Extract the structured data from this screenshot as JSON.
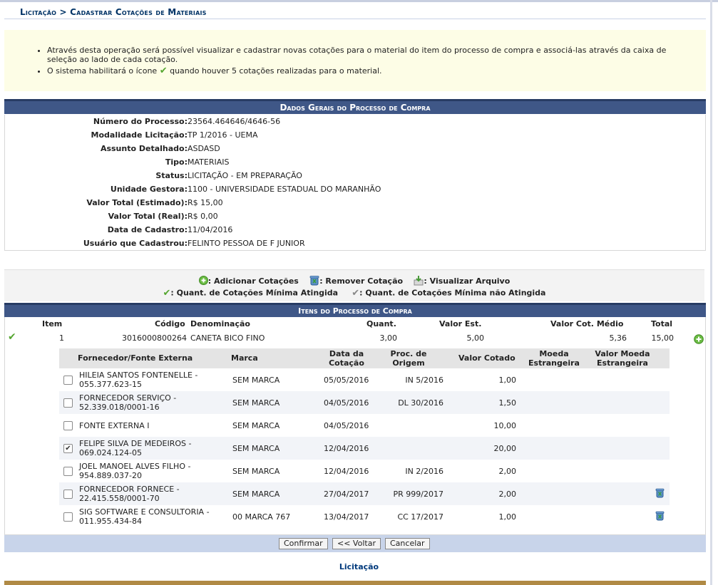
{
  "breadcrumb": "Licitação > Cadastrar Cotações de Materiais",
  "info": {
    "line1": "Através desta operação será possível visualizar e cadastrar novas cotações para o material do item do processo de compra e associá-las através da caixa de seleção ao lado de cada cotação.",
    "line2_a": "O sistema habilitará o ícone",
    "line2_b": "quando houver 5 cotações realizadas para o material."
  },
  "general": {
    "title": "Dados Gerais do Processo de Compra",
    "fields": [
      {
        "label": "Número do Processo:",
        "value": "23564.464646/4646-56"
      },
      {
        "label": "Modalidade Licitação:",
        "value": "TP 1/2016 - UEMA"
      },
      {
        "label": "Assunto Detalhado:",
        "value": "ASDASD"
      },
      {
        "label": "Tipo:",
        "value": "MATERIAIS"
      },
      {
        "label": "Status:",
        "value": "LICITAÇÃO - EM PREPARAÇÃO"
      },
      {
        "label": "Unidade Gestora:",
        "value": "1100 - UNIVERSIDADE ESTADUAL DO MARANHÃO"
      },
      {
        "label": "Valor Total (Estimado):",
        "value": "R$ 15,00"
      },
      {
        "label": "Valor Total (Real):",
        "value": "R$ 0,00"
      },
      {
        "label": "Data de Cadastro:",
        "value": "11/04/2016"
      },
      {
        "label": "Usuário que Cadastrou:",
        "value": "FELINTO PESSOA DE F JUNIOR"
      }
    ]
  },
  "legend": {
    "add": ": Adicionar Cotações",
    "remove": ": Remover Cotação",
    "view": ": Visualizar Arquivo",
    "min_reached": ": Quant. de Cotações Mínima Atingida",
    "min_not_reached": ": Quant. de Cotações Mínima não Atingida"
  },
  "items": {
    "title": "Itens do Processo de Compra",
    "headers": {
      "item": "Item",
      "codigo": "Código",
      "denominacao": "Denominação",
      "quant": "Quant.",
      "valor_est": "Valor Est.",
      "valor_cot_medio": "Valor Cot. Médio",
      "total": "Total"
    },
    "row": {
      "item": "1",
      "codigo": "3016000800264",
      "denominacao": "CANETA BICO FINO",
      "quant": "3,00",
      "valor_est": "5,00",
      "valor_cot_medio": "5,36",
      "total": "15,00"
    }
  },
  "quotes": {
    "headers": {
      "fornecedor": "Fornecedor/Fonte Externa",
      "marca": "Marca",
      "data_l1": "Data da",
      "data_l2": "Cotação",
      "proc_l1": "Proc. de",
      "proc_l2": "Origem",
      "valor": "Valor Cotado",
      "moeda_l1": "Moeda",
      "moeda_l2": "Estrangeira",
      "vmoeda_l1": "Valor Moeda",
      "vmoeda_l2": "Estrangeira"
    },
    "rows": [
      {
        "f1": "HILEIA SANTOS FONTENELLE -",
        "f2": "055.377.623-15",
        "marca": "SEM MARCA",
        "data": "05/05/2016",
        "proc": "IN 5/2016",
        "valor": "1,00",
        "checked": false,
        "trash": false
      },
      {
        "f1": "FORNECEDOR SERVIÇO -",
        "f2": "52.339.018/0001-16",
        "marca": "SEM MARCA",
        "data": "04/05/2016",
        "proc": "DL 30/2016",
        "valor": "1,50",
        "checked": false,
        "trash": false
      },
      {
        "f1": "FONTE EXTERNA I",
        "f2": "",
        "marca": "SEM MARCA",
        "data": "04/05/2016",
        "proc": "",
        "valor": "10,00",
        "checked": false,
        "trash": false
      },
      {
        "f1": "FELIPE SILVA DE MEDEIROS -",
        "f2": "069.024.124-05",
        "marca": "SEM MARCA",
        "data": "12/04/2016",
        "proc": "",
        "valor": "20,00",
        "checked": true,
        "trash": false
      },
      {
        "f1": "JOEL MANOEL ALVES FILHO -",
        "f2": "954.889.037-20",
        "marca": "SEM MARCA",
        "data": "12/04/2016",
        "proc": "IN 2/2016",
        "valor": "2,00",
        "checked": false,
        "trash": false
      },
      {
        "f1": "FORNECEDOR FORNECE -",
        "f2": "22.415.558/0001-70",
        "marca": "SEM MARCA",
        "data": "27/04/2017",
        "proc": "PR 999/2017",
        "valor": "2,00",
        "checked": false,
        "trash": true
      },
      {
        "f1": "SIG SOFTWARE E CONSULTORIA -",
        "f2": "011.955.434-84",
        "marca": "00 MARCA 767",
        "data": "13/04/2017",
        "proc": "CC 17/2017",
        "valor": "1,00",
        "checked": false,
        "trash": true
      }
    ]
  },
  "buttons": {
    "confirm": "Confirmar",
    "back": "<< Voltar",
    "cancel": "Cancelar"
  },
  "footer": "Licitação",
  "colors": {
    "header": "#3f5787",
    "check_green": "#55a630",
    "link": "#003a7c"
  }
}
